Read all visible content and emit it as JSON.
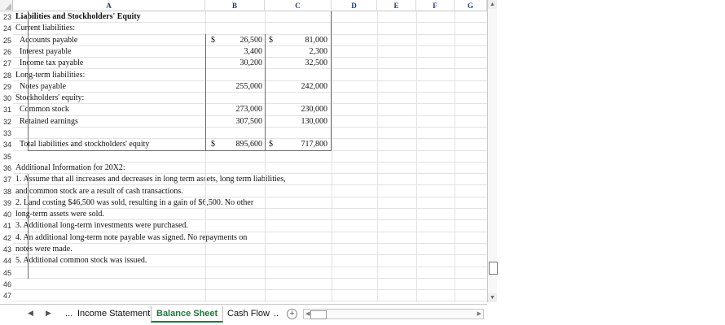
{
  "columns": [
    "A",
    "B",
    "C",
    "D",
    "E",
    "F",
    "G"
  ],
  "rows": [
    {
      "num": "23",
      "a": "Liabilities and Stockholders' Equity",
      "bold": true
    },
    {
      "num": "24",
      "a": "Current liabilities:"
    },
    {
      "num": "25",
      "a": "Accounts payable",
      "b_cur": "$",
      "b": "26,500",
      "c_cur": "$",
      "c": "81,000",
      "indent": true
    },
    {
      "num": "26",
      "a": "Interest payable",
      "b": "3,400",
      "c": "2,300",
      "indent": true
    },
    {
      "num": "27",
      "a": "Income tax payable",
      "b": "30,200",
      "c": "32,500",
      "indent": true
    },
    {
      "num": "28",
      "a": "Long-term liabilities:"
    },
    {
      "num": "29",
      "a": "Notes payable",
      "b": "255,000",
      "c": "242,000",
      "indent": true
    },
    {
      "num": "30",
      "a": "Stockholders' equity:"
    },
    {
      "num": "31",
      "a": "Common stock",
      "b": "273,000",
      "c": "230,000",
      "indent": true
    },
    {
      "num": "32",
      "a": "Retained earnings",
      "b": "307,500",
      "c": "130,000",
      "indent": true
    },
    {
      "num": "33",
      "a": ""
    },
    {
      "num": "34",
      "a": "Total liabilities and stockholders' equity",
      "b_cur": "$",
      "b": "895,600",
      "c_cur": "$",
      "c": "717,800",
      "indent": true
    },
    {
      "num": "35",
      "a": ""
    },
    {
      "num": "36",
      "a": "Additional Information for 20X2:"
    },
    {
      "num": "37",
      "a": "1. Assume that all increases and decreases in long term assets, long term liabilities,"
    },
    {
      "num": "38",
      "a": "and common stock are a result of cash transactions."
    },
    {
      "num": "39",
      "a": "2. Land costing $46,500 was sold, resulting in a gain of $6,500.  No other"
    },
    {
      "num": "40",
      "a": "long-term assets were sold."
    },
    {
      "num": "41",
      "a": "3. Additional long-term investments were purchased."
    },
    {
      "num": "42",
      "a": "4. An additional long-term note payable was signed.  No repayments on"
    },
    {
      "num": "43",
      "a": "notes were made."
    },
    {
      "num": "44",
      "a": "5. Additional common stock was issued."
    },
    {
      "num": "45",
      "a": ""
    },
    {
      "num": "46",
      "a": ""
    },
    {
      "num": "47",
      "a": ""
    }
  ],
  "tabs": {
    "ellipsis": "...",
    "income_statement": "Income Statement",
    "balance_sheet": "Balance Sheet",
    "cash_flow": "Cash Flow",
    "more": ".."
  },
  "colors": {
    "active_tab": "#1d7a3c",
    "col_header": "#1f3a6e"
  }
}
